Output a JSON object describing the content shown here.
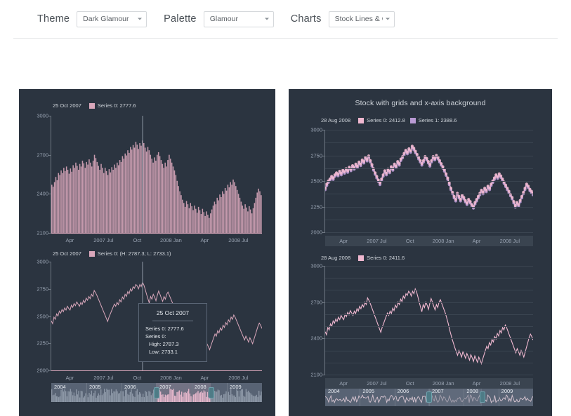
{
  "toolbar": {
    "theme_label": "Theme",
    "theme_value": "Dark Glamour",
    "palette_label": "Palette",
    "palette_value": "Glamour",
    "charts_label": "Charts",
    "charts_value": "Stock Lines & Colu"
  },
  "colors": {
    "panel_bg": "#2b3440",
    "series0": "#d9a7bb",
    "series1": "#b99ad4",
    "axis_text": "#9aa4b3",
    "grid": "#3a4450",
    "nav_handle": "#4e7b86"
  },
  "panels": {
    "left": {
      "charts": [
        {
          "id": "column-chart",
          "legend_date": "25 Oct 2007",
          "legend_items": [
            {
              "label": "Series 0: 2777.6",
              "color": "#d9a7bb"
            }
          ],
          "y_ticks": [
            "3000",
            "2700",
            "2400",
            "2100"
          ],
          "x_ticks": [
            "Apr",
            "2007 Jul",
            "Oct",
            "2008 Jan",
            "Apr",
            "2008 Jul"
          ]
        },
        {
          "id": "hilo-line-chart",
          "legend_date": "25 Oct 2007",
          "legend_items": [
            {
              "label": "Series 0: (H: 2787.3; L: 2733.1)",
              "color": "#d9a7bb"
            }
          ],
          "y_ticks": [
            "3000",
            "2750",
            "2500",
            "2250",
            "2000"
          ],
          "x_ticks": [
            "Apr",
            "2007 Jul",
            "Oct",
            "2008 Jan",
            "Apr",
            "2008 Jul"
          ],
          "tooltip": {
            "title": "25 Oct 2007",
            "rows": [
              "Series 0: 2777.6",
              "Series 0:"
            ],
            "indented_rows": [
              "High: 2787.3",
              "Low: 2733.1"
            ]
          },
          "navigator": {
            "years": [
              "2004",
              "2005",
              "2006",
              "2007",
              "2008",
              "2009"
            ]
          }
        }
      ]
    },
    "right": {
      "title": "Stock with grids and x-axis background",
      "charts": [
        {
          "id": "marker-stock-chart",
          "legend_date": "28 Aug 2008",
          "legend_items": [
            {
              "label": "Series 0: 2412.8",
              "color": "#f0b8d0"
            },
            {
              "label": "Series 1: 2388.6",
              "color": "#b99ad4"
            }
          ],
          "y_ticks": [
            "3000",
            "2750",
            "2500",
            "2250",
            "2000"
          ],
          "x_ticks": [
            "Apr",
            "2007 Jul",
            "Oct",
            "2008 Jan",
            "Apr",
            "2008 Jul"
          ]
        },
        {
          "id": "line-stock-chart",
          "legend_date": "28 Aug 2008",
          "legend_items": [
            {
              "label": "Series 0: 2411.6",
              "color": "#f0b8d0"
            }
          ],
          "y_ticks": [
            "3000",
            "2700",
            "2400",
            "2100"
          ],
          "x_ticks": [
            "Apr",
            "2007 Jul",
            "Oct",
            "2008 Jan",
            "Apr",
            "2008 Jul"
          ],
          "navigator": {
            "years": [
              "2004",
              "2005",
              "2006",
              "2007",
              "2008",
              "2009"
            ]
          }
        }
      ]
    }
  },
  "chart_data": [
    {
      "type": "bar",
      "id": "column-chart",
      "title": "",
      "xlabel": "",
      "ylabel": "",
      "ylim": [
        2100,
        3000
      ],
      "grid": false,
      "legend": "Series 0: 2777.6",
      "xtick_labels": [
        "Apr",
        "2007 Jul",
        "Oct",
        "2008 Jan",
        "Apr",
        "2008 Jul"
      ],
      "ytick_labels": [
        "3000",
        "2700",
        "2400",
        "2100"
      ],
      "highlight": {
        "date": "25 Oct 2007",
        "value": 2777.6
      },
      "series": [
        {
          "name": "Series 0",
          "color": "#d9a7bb",
          "values": [
            2470,
            2455,
            2490,
            2530,
            2505,
            2560,
            2545,
            2580,
            2560,
            2600,
            2575,
            2610,
            2585,
            2555,
            2595,
            2570,
            2620,
            2600,
            2640,
            2615,
            2585,
            2630,
            2610,
            2655,
            2635,
            2600,
            2645,
            2625,
            2665,
            2640,
            2610,
            2655,
            2700,
            2675,
            2645,
            2615,
            2585,
            2630,
            2600,
            2560,
            2600,
            2575,
            2545,
            2590,
            2565,
            2605,
            2585,
            2625,
            2600,
            2640,
            2620,
            2660,
            2645,
            2690,
            2670,
            2710,
            2695,
            2735,
            2715,
            2760,
            2740,
            2775,
            2755,
            2800,
            2778,
            2745,
            2790,
            2770,
            2810,
            2790,
            2755,
            2725,
            2760,
            2735,
            2700,
            2670,
            2640,
            2680,
            2655,
            2700,
            2720,
            2690,
            2660,
            2630,
            2600,
            2640,
            2610,
            2660,
            2700,
            2670,
            2640,
            2610,
            2580,
            2545,
            2500,
            2460,
            2420,
            2390,
            2355,
            2330,
            2300,
            2345,
            2320,
            2290,
            2330,
            2305,
            2275,
            2310,
            2285,
            2255,
            2300,
            2275,
            2245,
            2285,
            2260,
            2230,
            2265,
            2240,
            2215,
            2250,
            2280,
            2310,
            2340,
            2320,
            2370,
            2350,
            2395,
            2375,
            2420,
            2400,
            2445,
            2425,
            2470,
            2450,
            2490,
            2470,
            2510,
            2490,
            2460,
            2430,
            2400,
            2370,
            2340,
            2310,
            2285,
            2320,
            2295,
            2265,
            2305,
            2280,
            2250,
            2290,
            2330,
            2370,
            2410,
            2440,
            2420,
            2390
          ]
        }
      ]
    },
    {
      "type": "line",
      "id": "hilo-line-chart",
      "title": "",
      "ylim": [
        2000,
        3000
      ],
      "grid": false,
      "legend": "Series 0: (H: 2787.3; L: 2733.1)",
      "xtick_labels": [
        "Apr",
        "2007 Jul",
        "Oct",
        "2008 Jan",
        "Apr",
        "2008 Jul"
      ],
      "ytick_labels": [
        "3000",
        "2750",
        "2500",
        "2250",
        "2000"
      ],
      "highlight": {
        "date": "25 Oct 2007",
        "value": 2777.6,
        "high": 2787.3,
        "low": 2733.1
      },
      "series": [
        {
          "name": "Series 0",
          "color": "#d9a7bb",
          "values": [
            2455,
            2430,
            2490,
            2470,
            2520,
            2500,
            2545,
            2525,
            2560,
            2540,
            2575,
            2555,
            2590,
            2570,
            2555,
            2600,
            2580,
            2615,
            2595,
            2630,
            2610,
            2590,
            2625,
            2605,
            2645,
            2625,
            2665,
            2645,
            2680,
            2660,
            2700,
            2680,
            2735,
            2715,
            2690,
            2660,
            2630,
            2600,
            2570,
            2540,
            2510,
            2480,
            2450,
            2490,
            2520,
            2550,
            2580,
            2610,
            2590,
            2625,
            2605,
            2650,
            2630,
            2675,
            2655,
            2700,
            2680,
            2725,
            2705,
            2750,
            2730,
            2770,
            2755,
            2790,
            2778,
            2750,
            2790,
            2770,
            2810,
            2785,
            2745,
            2700,
            2660,
            2620,
            2680,
            2655,
            2700,
            2675,
            2640,
            2690,
            2730,
            2700,
            2665,
            2635,
            2680,
            2655,
            2700,
            2720,
            2690,
            2660,
            2630,
            2600,
            2560,
            2520,
            2470,
            2430,
            2390,
            2355,
            2320,
            2290,
            2260,
            2300,
            2275,
            2245,
            2290,
            2265,
            2235,
            2275,
            2250,
            2220,
            2265,
            2240,
            2210,
            2255,
            2230,
            2200,
            2245,
            2220,
            2190,
            2230,
            2265,
            2300,
            2335,
            2315,
            2365,
            2345,
            2390,
            2370,
            2415,
            2395,
            2440,
            2420,
            2465,
            2445,
            2490,
            2470,
            2510,
            2490,
            2460,
            2430,
            2400,
            2370,
            2340,
            2310,
            2280,
            2315,
            2290,
            2260,
            2300,
            2275,
            2245,
            2285,
            2325,
            2365,
            2405,
            2435,
            2415,
            2385
          ]
        }
      ]
    },
    {
      "type": "line",
      "id": "marker-stock-chart",
      "title": "Stock with grids and x-axis background",
      "ylim": [
        2000,
        3000
      ],
      "grid": true,
      "legend_entries": [
        "Series 0: 2412.8",
        "Series 1: 2388.6"
      ],
      "xtick_labels": [
        "Apr",
        "2007 Jul",
        "Oct",
        "2008 Jan",
        "Apr",
        "2008 Jul"
      ],
      "ytick_labels": [
        "3000",
        "2750",
        "2500",
        "2250",
        "2000"
      ],
      "highlight": {
        "date": "28 Aug 2008",
        "series0": 2412.8,
        "series1": 2388.6
      },
      "series": [
        {
          "name": "Series 0",
          "color": "#f0b8d0",
          "values": [
            2430,
            2470,
            2500,
            2520,
            2545,
            2530,
            2560,
            2580,
            2565,
            2595,
            2575,
            2605,
            2590,
            2620,
            2600,
            2635,
            2615,
            2650,
            2630,
            2665,
            2645,
            2685,
            2665,
            2705,
            2690,
            2730,
            2710,
            2745,
            2700,
            2660,
            2620,
            2580,
            2545,
            2510,
            2480,
            2520,
            2560,
            2600,
            2575,
            2615,
            2595,
            2640,
            2620,
            2665,
            2645,
            2690,
            2670,
            2715,
            2740,
            2770,
            2800,
            2780,
            2815,
            2795,
            2840,
            2820,
            2790,
            2760,
            2730,
            2700,
            2670,
            2700,
            2740,
            2720,
            2690,
            2660,
            2700,
            2740,
            2720,
            2750,
            2730,
            2700,
            2670,
            2640,
            2610,
            2570,
            2530,
            2480,
            2430,
            2390,
            2350,
            2320,
            2380,
            2350,
            2320,
            2360,
            2340,
            2310,
            2285,
            2320,
            2300,
            2270,
            2250,
            2290,
            2320,
            2350,
            2380,
            2410,
            2390,
            2430,
            2410,
            2450,
            2430,
            2470,
            2500,
            2530,
            2560,
            2540,
            2570,
            2550,
            2520,
            2490,
            2460,
            2430,
            2400,
            2370,
            2340,
            2300,
            2260,
            2290,
            2270,
            2310,
            2350,
            2390,
            2430,
            2470,
            2450,
            2420,
            2400,
            2380
          ]
        },
        {
          "name": "Series 1",
          "color": "#b99ad4",
          "values": [
            2415,
            2455,
            2485,
            2505,
            2530,
            2515,
            2545,
            2565,
            2550,
            2580,
            2560,
            2590,
            2575,
            2605,
            2585,
            2620,
            2600,
            2635,
            2615,
            2650,
            2630,
            2670,
            2650,
            2690,
            2675,
            2715,
            2695,
            2730,
            2685,
            2645,
            2605,
            2565,
            2530,
            2495,
            2465,
            2505,
            2545,
            2585,
            2560,
            2600,
            2580,
            2625,
            2605,
            2650,
            2630,
            2675,
            2655,
            2700,
            2725,
            2755,
            2785,
            2765,
            2800,
            2780,
            2825,
            2805,
            2775,
            2745,
            2715,
            2685,
            2655,
            2685,
            2725,
            2705,
            2675,
            2645,
            2685,
            2725,
            2705,
            2735,
            2715,
            2685,
            2655,
            2625,
            2595,
            2555,
            2515,
            2465,
            2415,
            2375,
            2335,
            2305,
            2365,
            2335,
            2305,
            2345,
            2325,
            2295,
            2270,
            2305,
            2285,
            2255,
            2235,
            2275,
            2305,
            2335,
            2365,
            2395,
            2375,
            2415,
            2395,
            2435,
            2415,
            2455,
            2485,
            2515,
            2545,
            2525,
            2555,
            2535,
            2505,
            2475,
            2445,
            2415,
            2385,
            2355,
            2325,
            2285,
            2245,
            2275,
            2255,
            2295,
            2335,
            2375,
            2415,
            2455,
            2435,
            2405,
            2385,
            2365
          ]
        }
      ]
    },
    {
      "type": "line",
      "id": "line-stock-chart",
      "title": "",
      "ylim": [
        2100,
        3000
      ],
      "grid": true,
      "legend": "Series 0: 2411.6",
      "xtick_labels": [
        "Apr",
        "2007 Jul",
        "Oct",
        "2008 Jan",
        "Apr",
        "2008 Jul"
      ],
      "ytick_labels": [
        "3000",
        "2700",
        "2400",
        "2100"
      ],
      "highlight": {
        "date": "28 Aug 2008",
        "value": 2411.6
      },
      "series": [
        {
          "name": "Series 0",
          "color": "#f0b8d0",
          "values": [
            2455,
            2430,
            2490,
            2470,
            2520,
            2500,
            2545,
            2525,
            2560,
            2540,
            2575,
            2555,
            2590,
            2570,
            2555,
            2600,
            2580,
            2615,
            2595,
            2630,
            2610,
            2590,
            2625,
            2605,
            2645,
            2625,
            2665,
            2645,
            2680,
            2660,
            2700,
            2680,
            2735,
            2715,
            2690,
            2660,
            2630,
            2600,
            2570,
            2540,
            2510,
            2480,
            2450,
            2490,
            2520,
            2550,
            2580,
            2610,
            2590,
            2625,
            2605,
            2650,
            2630,
            2675,
            2655,
            2700,
            2680,
            2725,
            2705,
            2750,
            2730,
            2770,
            2755,
            2790,
            2778,
            2750,
            2790,
            2770,
            2810,
            2785,
            2745,
            2700,
            2660,
            2620,
            2680,
            2655,
            2700,
            2675,
            2640,
            2690,
            2730,
            2700,
            2665,
            2635,
            2680,
            2655,
            2700,
            2720,
            2690,
            2660,
            2630,
            2600,
            2560,
            2520,
            2470,
            2430,
            2390,
            2355,
            2320,
            2290,
            2260,
            2300,
            2275,
            2245,
            2290,
            2265,
            2235,
            2275,
            2250,
            2220,
            2265,
            2240,
            2210,
            2255,
            2230,
            2200,
            2245,
            2220,
            2190,
            2230,
            2265,
            2300,
            2335,
            2315,
            2365,
            2345,
            2390,
            2370,
            2415,
            2395,
            2440,
            2420,
            2465,
            2445,
            2490,
            2470,
            2510,
            2490,
            2460,
            2430,
            2400,
            2370,
            2340,
            2310,
            2280,
            2315,
            2290,
            2260,
            2300,
            2275,
            2245,
            2285,
            2325,
            2365,
            2405,
            2435,
            2415,
            2385
          ]
        }
      ]
    }
  ]
}
